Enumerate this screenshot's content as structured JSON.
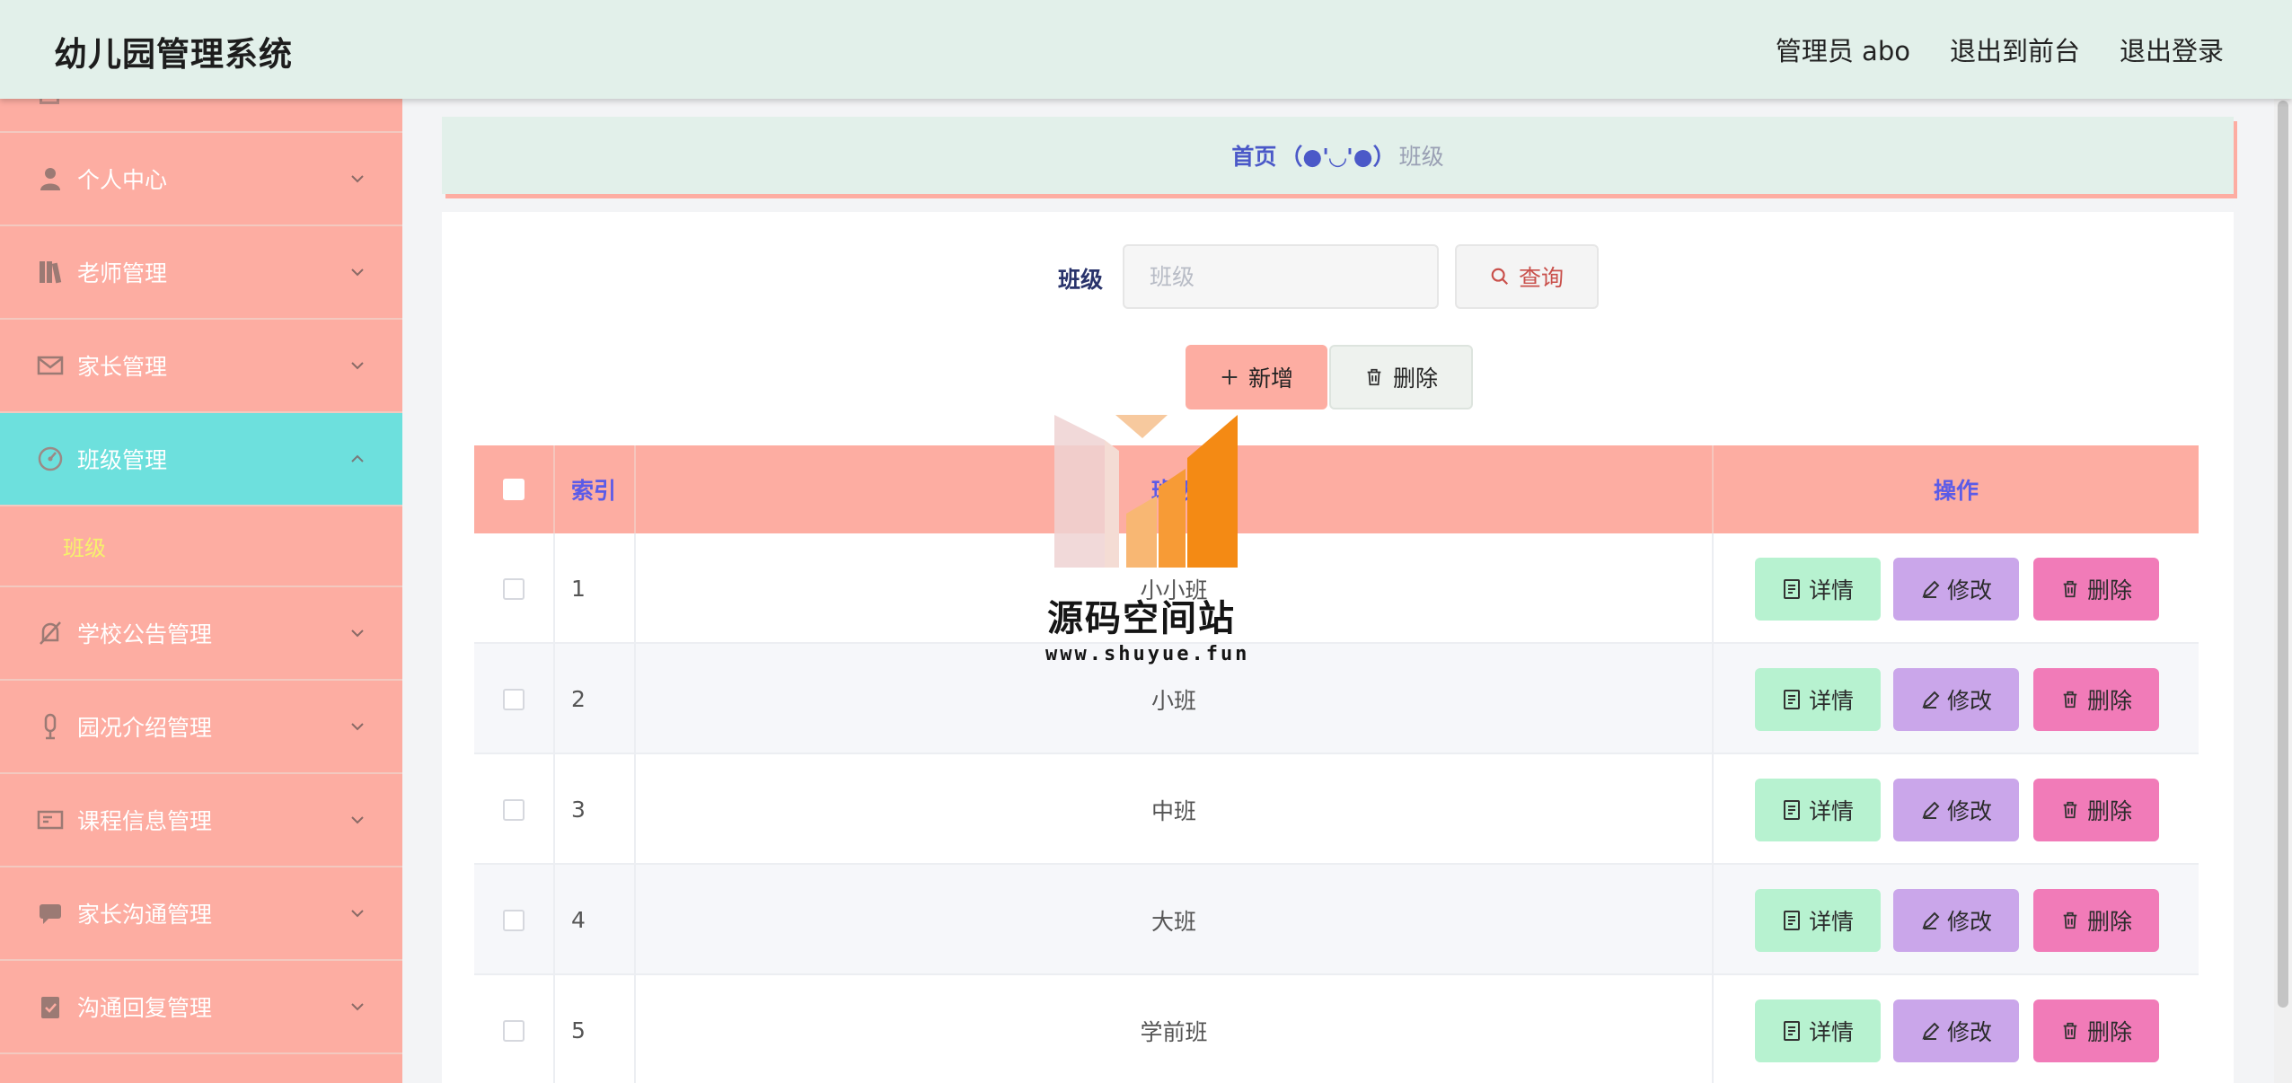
{
  "header": {
    "title": "幼儿园管理系统",
    "admin": "管理员 abo",
    "to_front": "退出到前台",
    "logout": "退出登录"
  },
  "sidebar": {
    "items": [
      {
        "label": "个人中心",
        "icon": "person-icon"
      },
      {
        "label": "老师管理",
        "icon": "books-icon"
      },
      {
        "label": "家长管理",
        "icon": "envelope-icon"
      },
      {
        "label": "班级管理",
        "icon": "gauge-icon",
        "active": true
      },
      {
        "label": "学校公告管理",
        "icon": "bell-off-icon"
      },
      {
        "label": "园况介绍管理",
        "icon": "microphone-icon"
      },
      {
        "label": "课程信息管理",
        "icon": "id-card-icon"
      },
      {
        "label": "家长沟通管理",
        "icon": "chat-icon"
      },
      {
        "label": "沟通回复管理",
        "icon": "clipboard-icon"
      }
    ],
    "sub_item": "班级"
  },
  "breadcrumb": {
    "home": "首页",
    "emoticon": "（●'◡'●）",
    "current": "班级"
  },
  "search": {
    "label": "班级",
    "placeholder": "班级",
    "button": "查询"
  },
  "actions": {
    "add": "新增",
    "delete": "删除"
  },
  "table": {
    "headers": {
      "index": "索引",
      "class": "班级",
      "ops": "操作"
    },
    "rows": [
      {
        "index": "1",
        "name": "小小班"
      },
      {
        "index": "2",
        "name": "小班"
      },
      {
        "index": "3",
        "name": "中班"
      },
      {
        "index": "4",
        "name": "大班"
      },
      {
        "index": "5",
        "name": "学前班"
      }
    ],
    "op_labels": {
      "detail": "详情",
      "edit": "修改",
      "delete": "删除"
    }
  },
  "watermark": {
    "title": "源码空间站",
    "url": "www.shuyue.fun"
  },
  "colors": {
    "sidebar": "#fdada2",
    "active": "#6de0dd",
    "header": "#e2f0ea",
    "detail": "#b7f2d0",
    "edit": "#caa6ea",
    "delete": "#f17bb8"
  }
}
